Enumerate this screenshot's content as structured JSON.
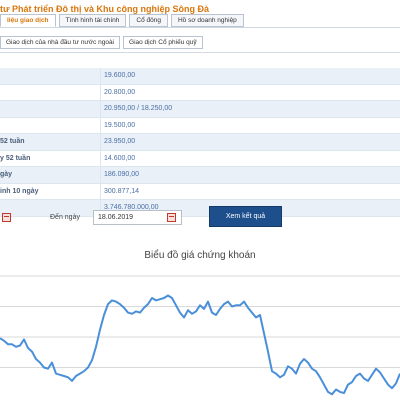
{
  "header": {
    "company_title": "tư Phát triển Đô thị và Khu công nghiệp Sông Đà"
  },
  "tabs_primary": [
    {
      "label": "liệu giao dịch",
      "active": true
    },
    {
      "label": "Tình hình tài chính",
      "active": false
    },
    {
      "label": "Cổ đông",
      "active": false
    },
    {
      "label": "Hồ sơ doanh nghiệp",
      "active": false
    }
  ],
  "tabs_secondary": [
    {
      "label": "Giao dịch của nhà đầu tư nước ngoài"
    },
    {
      "label": "Giao dịch Cổ phiếu quỹ"
    }
  ],
  "stats": [
    {
      "label": "",
      "value": "19.600,00"
    },
    {
      "label": "",
      "value": "20.800,00"
    },
    {
      "label": "",
      "value": "20.950,00 / 18.250,00"
    },
    {
      "label": "",
      "value": "19.500,00"
    },
    {
      "label": "52 tuần",
      "value": "23.950,00"
    },
    {
      "label": "y 52 tuần",
      "value": "14.600,00"
    },
    {
      "label": "gày",
      "value": "186.090,00"
    },
    {
      "label": "inh 10 ngày",
      "value": "300.877,14"
    },
    {
      "label": "",
      "value": "3.746.780.000,00"
    }
  ],
  "date_filter": {
    "to_label": "Đến ngày",
    "to_value": "18.06.2019",
    "submit_label": "Xem kết quả"
  },
  "colors": {
    "accent": "#d8760c",
    "button": "#1d4f8c",
    "line": "#4a8fd9"
  },
  "chart_data": {
    "type": "line",
    "title": "Biểu đồ giá chứng khoán",
    "xlabel": "",
    "ylabel": "",
    "grid": true,
    "y_domain": [
      0,
      100
    ],
    "x": [
      0,
      4,
      8,
      12,
      16,
      20,
      24,
      28,
      32,
      36,
      40,
      44,
      48,
      52,
      56,
      60,
      64,
      68,
      72,
      76,
      80,
      84,
      88,
      92,
      96,
      100,
      104,
      108,
      112,
      116,
      120,
      124,
      128,
      132,
      136,
      140,
      144,
      148,
      152,
      156,
      160,
      164,
      168,
      172,
      176,
      180,
      184,
      188,
      192,
      196,
      200,
      204,
      208,
      212,
      216,
      220,
      224,
      228,
      232,
      236,
      240,
      244,
      248,
      252,
      256,
      260,
      264,
      268,
      272,
      276,
      280,
      284,
      288,
      292,
      296,
      300,
      304,
      308,
      312,
      316,
      320,
      324,
      328,
      332,
      336,
      340,
      344,
      348,
      352,
      356,
      360,
      364,
      368,
      372,
      376,
      380,
      384,
      388,
      392,
      396,
      400
    ],
    "series": [
      {
        "values": [
          49,
          47,
          44,
          44,
          42,
          43,
          48,
          41,
          38,
          32,
          29,
          25,
          24,
          29,
          20,
          19,
          18,
          17,
          14,
          18,
          20,
          22,
          25,
          31,
          42,
          56,
          68,
          77,
          80,
          79,
          77,
          74,
          70,
          69,
          71,
          70,
          74,
          77,
          82,
          80,
          81,
          82,
          84,
          82,
          76,
          70,
          66,
          72,
          69,
          71,
          76,
          73,
          79,
          70,
          68,
          73,
          77,
          79,
          75,
          76,
          76,
          79,
          74,
          70,
          66,
          68,
          53,
          38,
          22,
          20,
          17,
          19,
          26,
          24,
          20,
          28,
          32,
          29,
          24,
          22,
          17,
          11,
          5,
          3,
          7,
          5,
          4,
          11,
          13,
          18,
          20,
          16,
          14,
          19,
          24,
          21,
          16,
          11,
          8,
          12,
          20
        ]
      }
    ]
  }
}
